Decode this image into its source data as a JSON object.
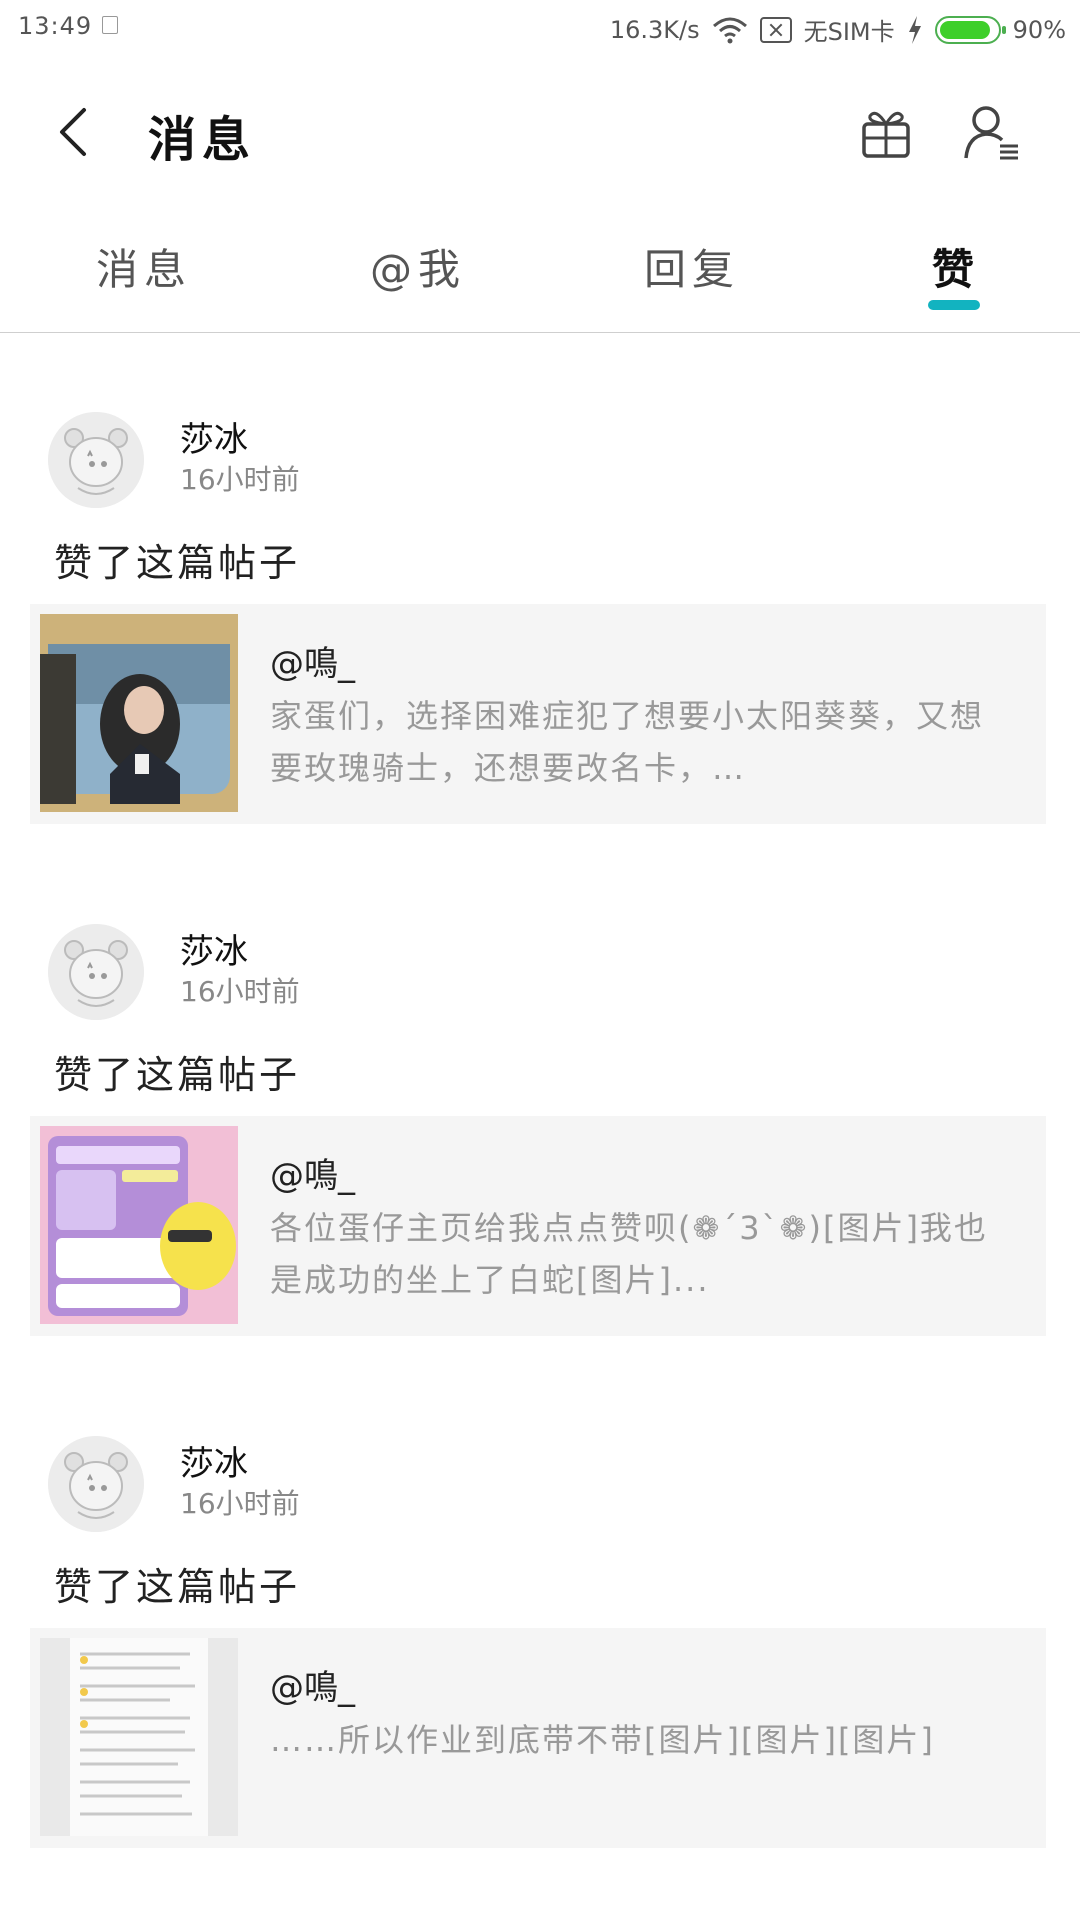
{
  "status_bar": {
    "time": "13:49",
    "network_speed": "16.3K/s",
    "sim_status": "无SIM卡",
    "battery_percent": "90%",
    "battery_level": 0.9,
    "icons": [
      "notification-icon",
      "wifi-icon",
      "no-sim-icon",
      "charging-bolt-icon",
      "battery-icon"
    ]
  },
  "header": {
    "title": "消息",
    "back_icon": "back-chevron-icon",
    "right_icons": [
      "gift-icon",
      "user-settings-icon"
    ]
  },
  "tabs": [
    {
      "label": "消息",
      "active": false
    },
    {
      "label": "@我",
      "active": false
    },
    {
      "label": "回复",
      "active": false
    },
    {
      "label": "赞",
      "active": true
    }
  ],
  "accent_color": "#12b3c0",
  "feed": [
    {
      "username": "莎冰",
      "time": "16小时前",
      "action": "赞了这篇帖子",
      "post": {
        "author": "@鳴_",
        "excerpt": "家蛋们，选择困难症犯了想要小太阳葵葵，又想要玫瑰骑士，还想要改名卡，…"
      }
    },
    {
      "username": "莎冰",
      "time": "16小时前",
      "action": "赞了这篇帖子",
      "post": {
        "author": "@鳴_",
        "excerpt": "各位蛋仔主页给我点点赞呗(❁´3`❁)[图片]我也是成功的坐上了白蛇[图片]..."
      }
    },
    {
      "username": "莎冰",
      "time": "16小时前",
      "action": "赞了这篇帖子",
      "post": {
        "author": "@鳴_",
        "excerpt": "……所以作业到底带不带[图片][图片][图片]"
      }
    }
  ]
}
